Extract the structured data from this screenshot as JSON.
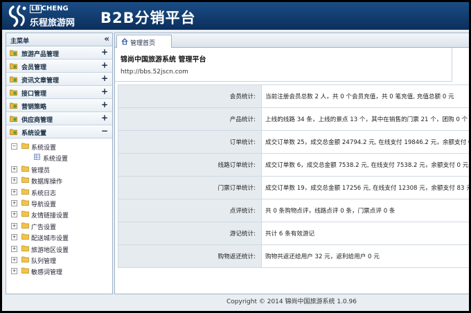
{
  "header": {
    "logo_en_prefix": "LB",
    "logo_en_suffix": "CHENG",
    "logo_cn": "乐程旅游网",
    "title": "B2B分销平台"
  },
  "sidebar": {
    "title": "主菜单",
    "collapse_glyph": "«",
    "menus": [
      {
        "label": "旅游产品管理",
        "toggle": "+"
      },
      {
        "label": "会员管理",
        "toggle": "+"
      },
      {
        "label": "资讯文章管理",
        "toggle": "+"
      },
      {
        "label": "接口管理",
        "toggle": "+"
      },
      {
        "label": "营销策略",
        "toggle": "+"
      },
      {
        "label": "供应商管理",
        "toggle": "+"
      },
      {
        "label": "系统设置",
        "toggle": "−"
      }
    ],
    "tree": {
      "expanded": {
        "label": "系统设置",
        "exp": "−",
        "child": "系统设置"
      },
      "items": [
        "管理员",
        "数据库操作",
        "系统日志",
        "导航设置",
        "友情链接设置",
        "广告设置",
        "配送城市设置",
        "旅游地区设置",
        "队列管理",
        "敏感词管理"
      ],
      "collapsed_glyph": "+"
    }
  },
  "main": {
    "tab": "管理首页",
    "intro_title": "锦尚中国旅游系统 管理平台",
    "intro_url": "http://bbs.52jscn.com",
    "stats": [
      {
        "label": "会员统计:",
        "value": "当前注册会员总数 2 人，共 0 个会员充值，共 0 笔充值, 充值总额 0 元"
      },
      {
        "label": "产品统计:",
        "value": "上线的线路 34 条，上线的景点 13 个，其中在销售的门票 21 个，团购 0 个"
      },
      {
        "label": "订单统计:",
        "value": "成交订单数 25，成交总金额 24794.2 元, 在线支付 19846.2 元，余额支付 0 元"
      },
      {
        "label": "线路订单统计:",
        "value": "成交订单数 6，成交总金额 7538.2 元, 在线支付 7538.2 元，余额支付 0 元"
      },
      {
        "label": "门票订单统计:",
        "value": "成交订单数 19，成交总金额 17256 元, 在线支付 12308 元，余额支付 83 元"
      },
      {
        "label": "点评统计:",
        "value": "共 0 条购物点评，线路点评 0 条，门票点评 0 条"
      },
      {
        "label": "游记统计:",
        "value": "共计 6 条有效游记"
      },
      {
        "label": "购物返还统计:",
        "value": "购物共返还给用户 32 元，返利给用户 0 元"
      }
    ]
  },
  "footer": {
    "copyright": "Copyright © 2014 锦尚中国旅游系统 1.0.96"
  },
  "colors": {
    "header": "#0b2f5c",
    "panel_border": "#9fb3c8",
    "label_cell": "#e6ebf0"
  },
  "icons": {
    "menu": "folder-plugin-icon",
    "tree_folder": "folder-icon",
    "tree_leaf": "grid-page-icon",
    "tab": "home-icon"
  }
}
